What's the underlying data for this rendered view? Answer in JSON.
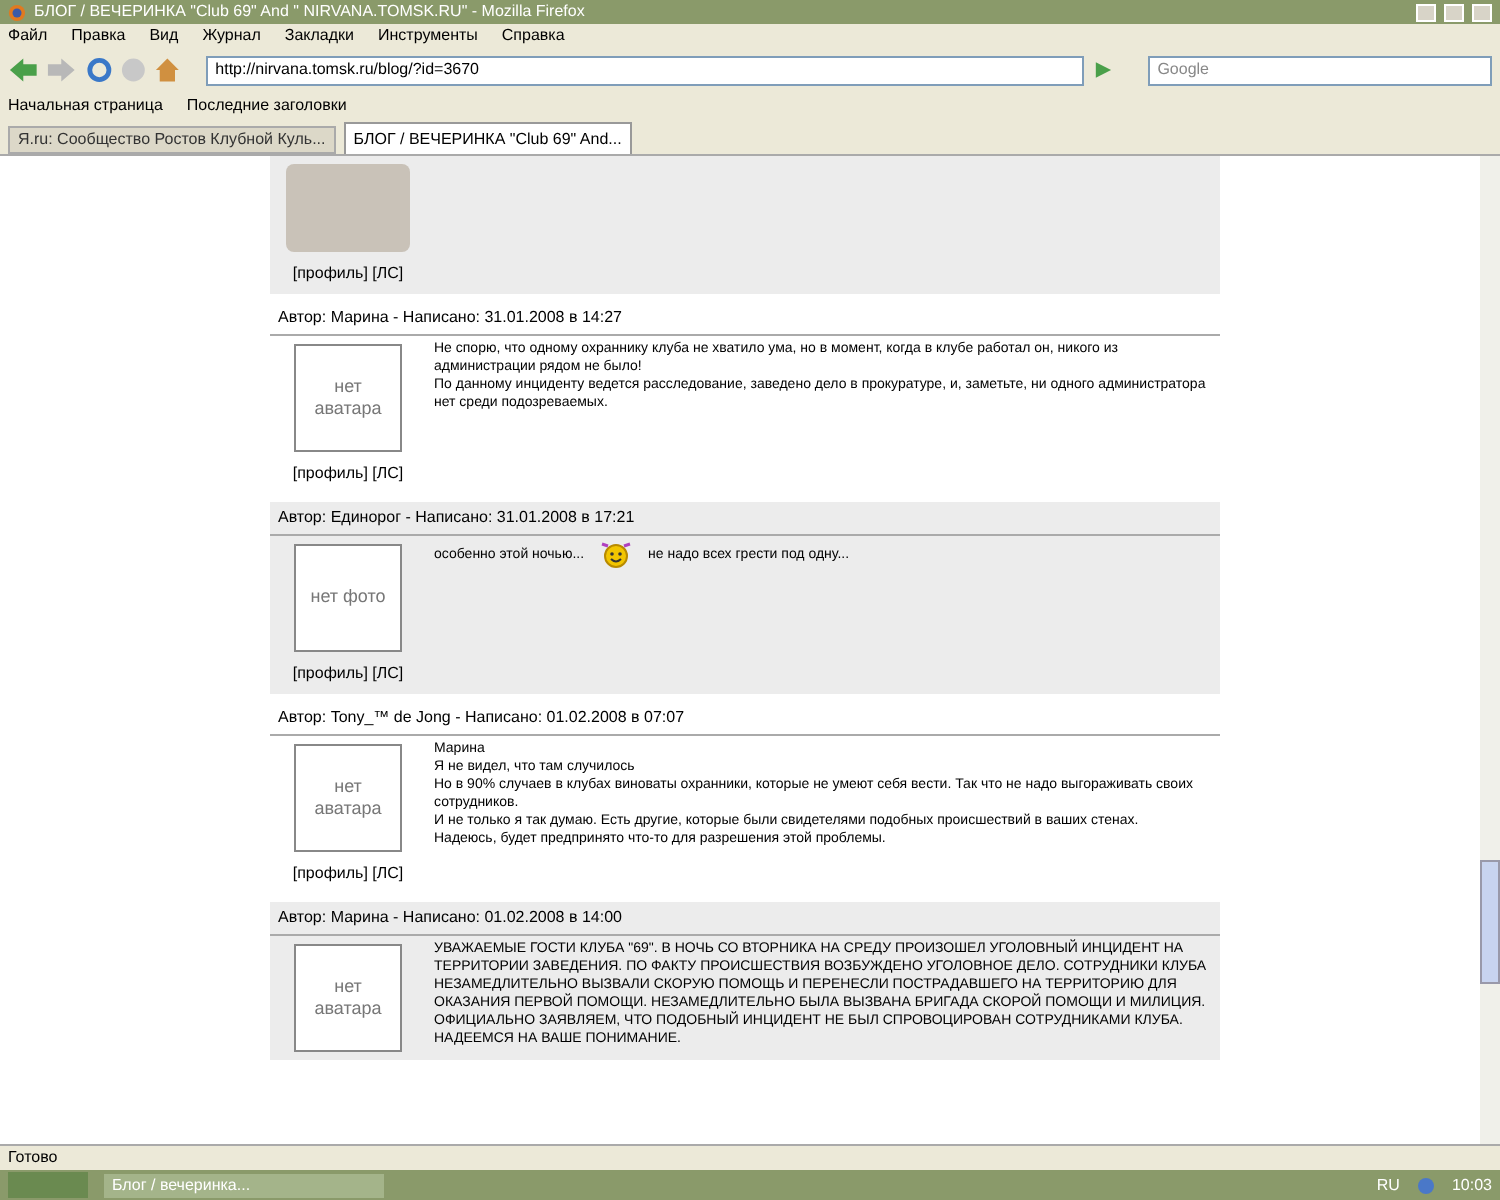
{
  "window": {
    "title": "БЛОГ / ВЕЧЕРИНКА \"Club 69\" And \" NIRVANA.TOMSK.RU\" - Mozilla Firefox"
  },
  "menu": [
    "Файл",
    "Правка",
    "Вид",
    "Журнал",
    "Закладки",
    "Инструменты",
    "Справка"
  ],
  "toolbar": {
    "url": "http://nirvana.tomsk.ru/blog/?id=3670",
    "search_placeholder": "Google"
  },
  "bookmarks": [
    "Начальная страница",
    "Последние заголовки"
  ],
  "tabs": [
    {
      "label": "Я.ru: Сообщество Ростов Клубной Куль...",
      "selected": false
    },
    {
      "label": "БЛОГ / ВЕЧЕРИНКА \"Club 69\" And...",
      "selected": true
    }
  ],
  "posts": [
    {
      "shaded": true,
      "avatar": {
        "kind": "photo"
      },
      "links": "[профиль] [ЛС]"
    },
    {
      "shaded": false,
      "header": "Автор: Марина - Написано: 31.01.2008 в 14:27",
      "avatar": {
        "kind": "none",
        "text": "нет аватара"
      },
      "links": "[профиль] [ЛС]",
      "paragraphs": [
        [
          {
            "kind": "text",
            "text": "Не спорю, что одному охраннику клуба не хватило ума, но в момент, когда в клубе работал он, никого из администрации рядом не было!"
          }
        ],
        [
          {
            "kind": "text",
            "text": "По данному инциденту ведется расследование, заведено дело в прокуратуре, и, заметьте, ни одного администратора нет среди подозреваемых."
          }
        ]
      ]
    },
    {
      "shaded": true,
      "header": "Автор: Единорог - Написано: 31.01.2008 в 17:21",
      "avatar": {
        "kind": "none",
        "text": "нет фото"
      },
      "links": "[профиль] [ЛС]",
      "paragraphs": [
        [
          {
            "kind": "text",
            "text": "особенно этой ночью..."
          },
          {
            "kind": "smiley"
          },
          {
            "kind": "text",
            "text": "не надо всех грести под одну..."
          }
        ]
      ]
    },
    {
      "shaded": false,
      "header": "Автор: Tony_™ de Jong - Написано: 01.02.2008 в 07:07",
      "avatar": {
        "kind": "none",
        "text": "нет аватара"
      },
      "links": "[профиль] [ЛС]",
      "paragraphs": [
        [
          {
            "kind": "text",
            "text": "Марина"
          }
        ],
        [
          {
            "kind": "text",
            "text": "Я не видел, что там случилось"
          }
        ],
        [
          {
            "kind": "text",
            "text": "Но в 90% случаев в клубах виноваты охранники, которые не умеют себя вести. Так что не надо выгораживать своих сотрудников."
          }
        ],
        [
          {
            "kind": "text",
            "text": "И не только я так думаю. Есть другие, которые были свидетелями подобных происшествий в ваших стенах."
          }
        ],
        [
          {
            "kind": "text",
            "text": "Надеюсь, будет предпринято что-то для разрешения этой проблемы."
          }
        ]
      ]
    },
    {
      "shaded": true,
      "header": "Автор: Марина - Написано: 01.02.2008 в 14:00",
      "avatar": {
        "kind": "none",
        "text": "нет аватара"
      },
      "paragraphs": [
        [
          {
            "kind": "text",
            "text": "УВАЖАЕМЫЕ ГОСТИ КЛУБА \"69\". В НОЧЬ СО ВТОРНИКА НА СРЕДУ ПРОИЗОШЕЛ УГОЛОВНЫЙ ИНЦИДЕНТ НА ТЕРРИТОРИИ ЗАВЕДЕНИЯ. ПО ФАКТУ ПРОИСШЕСТВИЯ ВОЗБУЖДЕНО УГОЛОВНОЕ ДЕЛО. СОТРУДНИКИ КЛУБА НЕЗАМЕДЛИТЕЛЬНО ВЫЗВАЛИ СКОРУЮ ПОМОЩЬ И ПЕРЕНЕСЛИ ПОСТРАДАВШЕГО НА ТЕРРИТОРИЮ ДЛЯ ОКАЗАНИЯ ПЕРВОЙ ПОМОЩИ. НЕЗАМЕДЛИТЕЛЬНО БЫЛА ВЫЗВАНА БРИГАДА СКОРОЙ ПОМОЩИ И МИЛИЦИЯ."
          }
        ],
        [
          {
            "kind": "text",
            "text": "ОФИЦИАЛЬНО ЗАЯВЛЯЕМ, ЧТО ПОДОБНЫЙ ИНЦИДЕНТ НЕ БЫЛ СПРОВОЦИРОВАН СОТРУДНИКАМИ КЛУБА. НАДЕЕМСЯ НА ВАШЕ ПОНИМАНИЕ."
          }
        ]
      ]
    }
  ],
  "status_bar": "Готово",
  "taskbar": {
    "task": "Блог / вечеринка...",
    "lang": "RU",
    "time": "10:03"
  }
}
